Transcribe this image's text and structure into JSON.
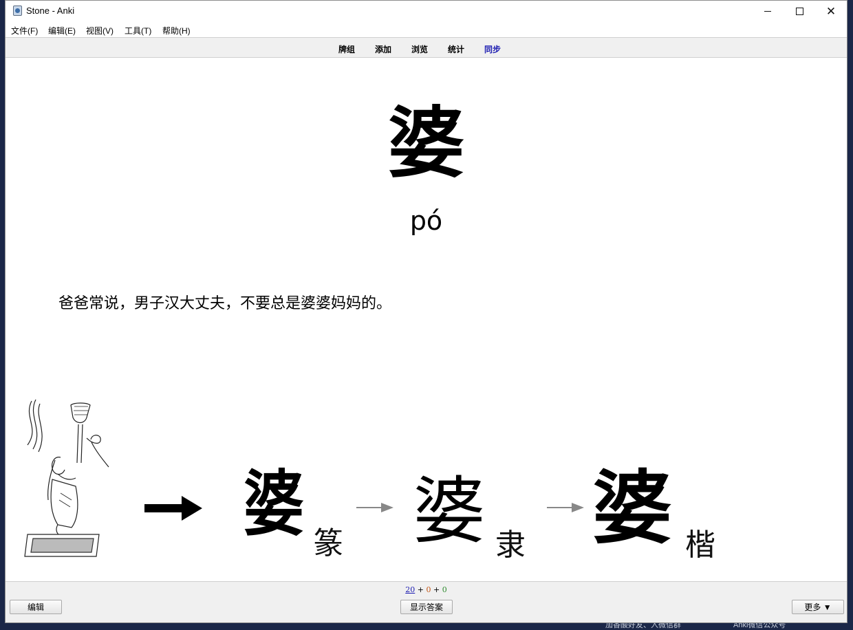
{
  "window": {
    "title": "Stone - Anki",
    "controls": {
      "minimize": "—",
      "maximize": "□",
      "close": "✕"
    }
  },
  "menu": {
    "items": [
      "文件(F)",
      "编辑(E)",
      "视图(V)",
      "工具(T)",
      "帮助(H)"
    ]
  },
  "toolbar": {
    "decks": "牌组",
    "add": "添加",
    "browse": "浏览",
    "stats": "统计",
    "sync": "同步"
  },
  "card": {
    "character": "婆",
    "pinyin": "pó",
    "sentence": "爸爸常说，男子汉大丈夫，不要总是婆婆妈妈的。",
    "evolution": {
      "seal_char": "婆",
      "seal_label": "篆",
      "clerical_char": "婆",
      "clerical_label": "隶",
      "regular_char": "婆",
      "regular_label": "楷"
    }
  },
  "bottom": {
    "counts": {
      "new": "20",
      "learning": "0",
      "review": "0",
      "separator": "+"
    },
    "edit_button": "编辑",
    "show_answer_button": "显示答案",
    "more_button": "更多 ▼"
  },
  "desktop": {
    "text_left": "加香酸好友、入微信群",
    "text_right": "Anki微信公众号"
  },
  "colors": {
    "sync_link": "#1a1ab0",
    "new_count": "#1a1ab0",
    "learning_count": "#c35617",
    "review_count": "#2e8b2e",
    "desktop_background": "#1b2748"
  }
}
